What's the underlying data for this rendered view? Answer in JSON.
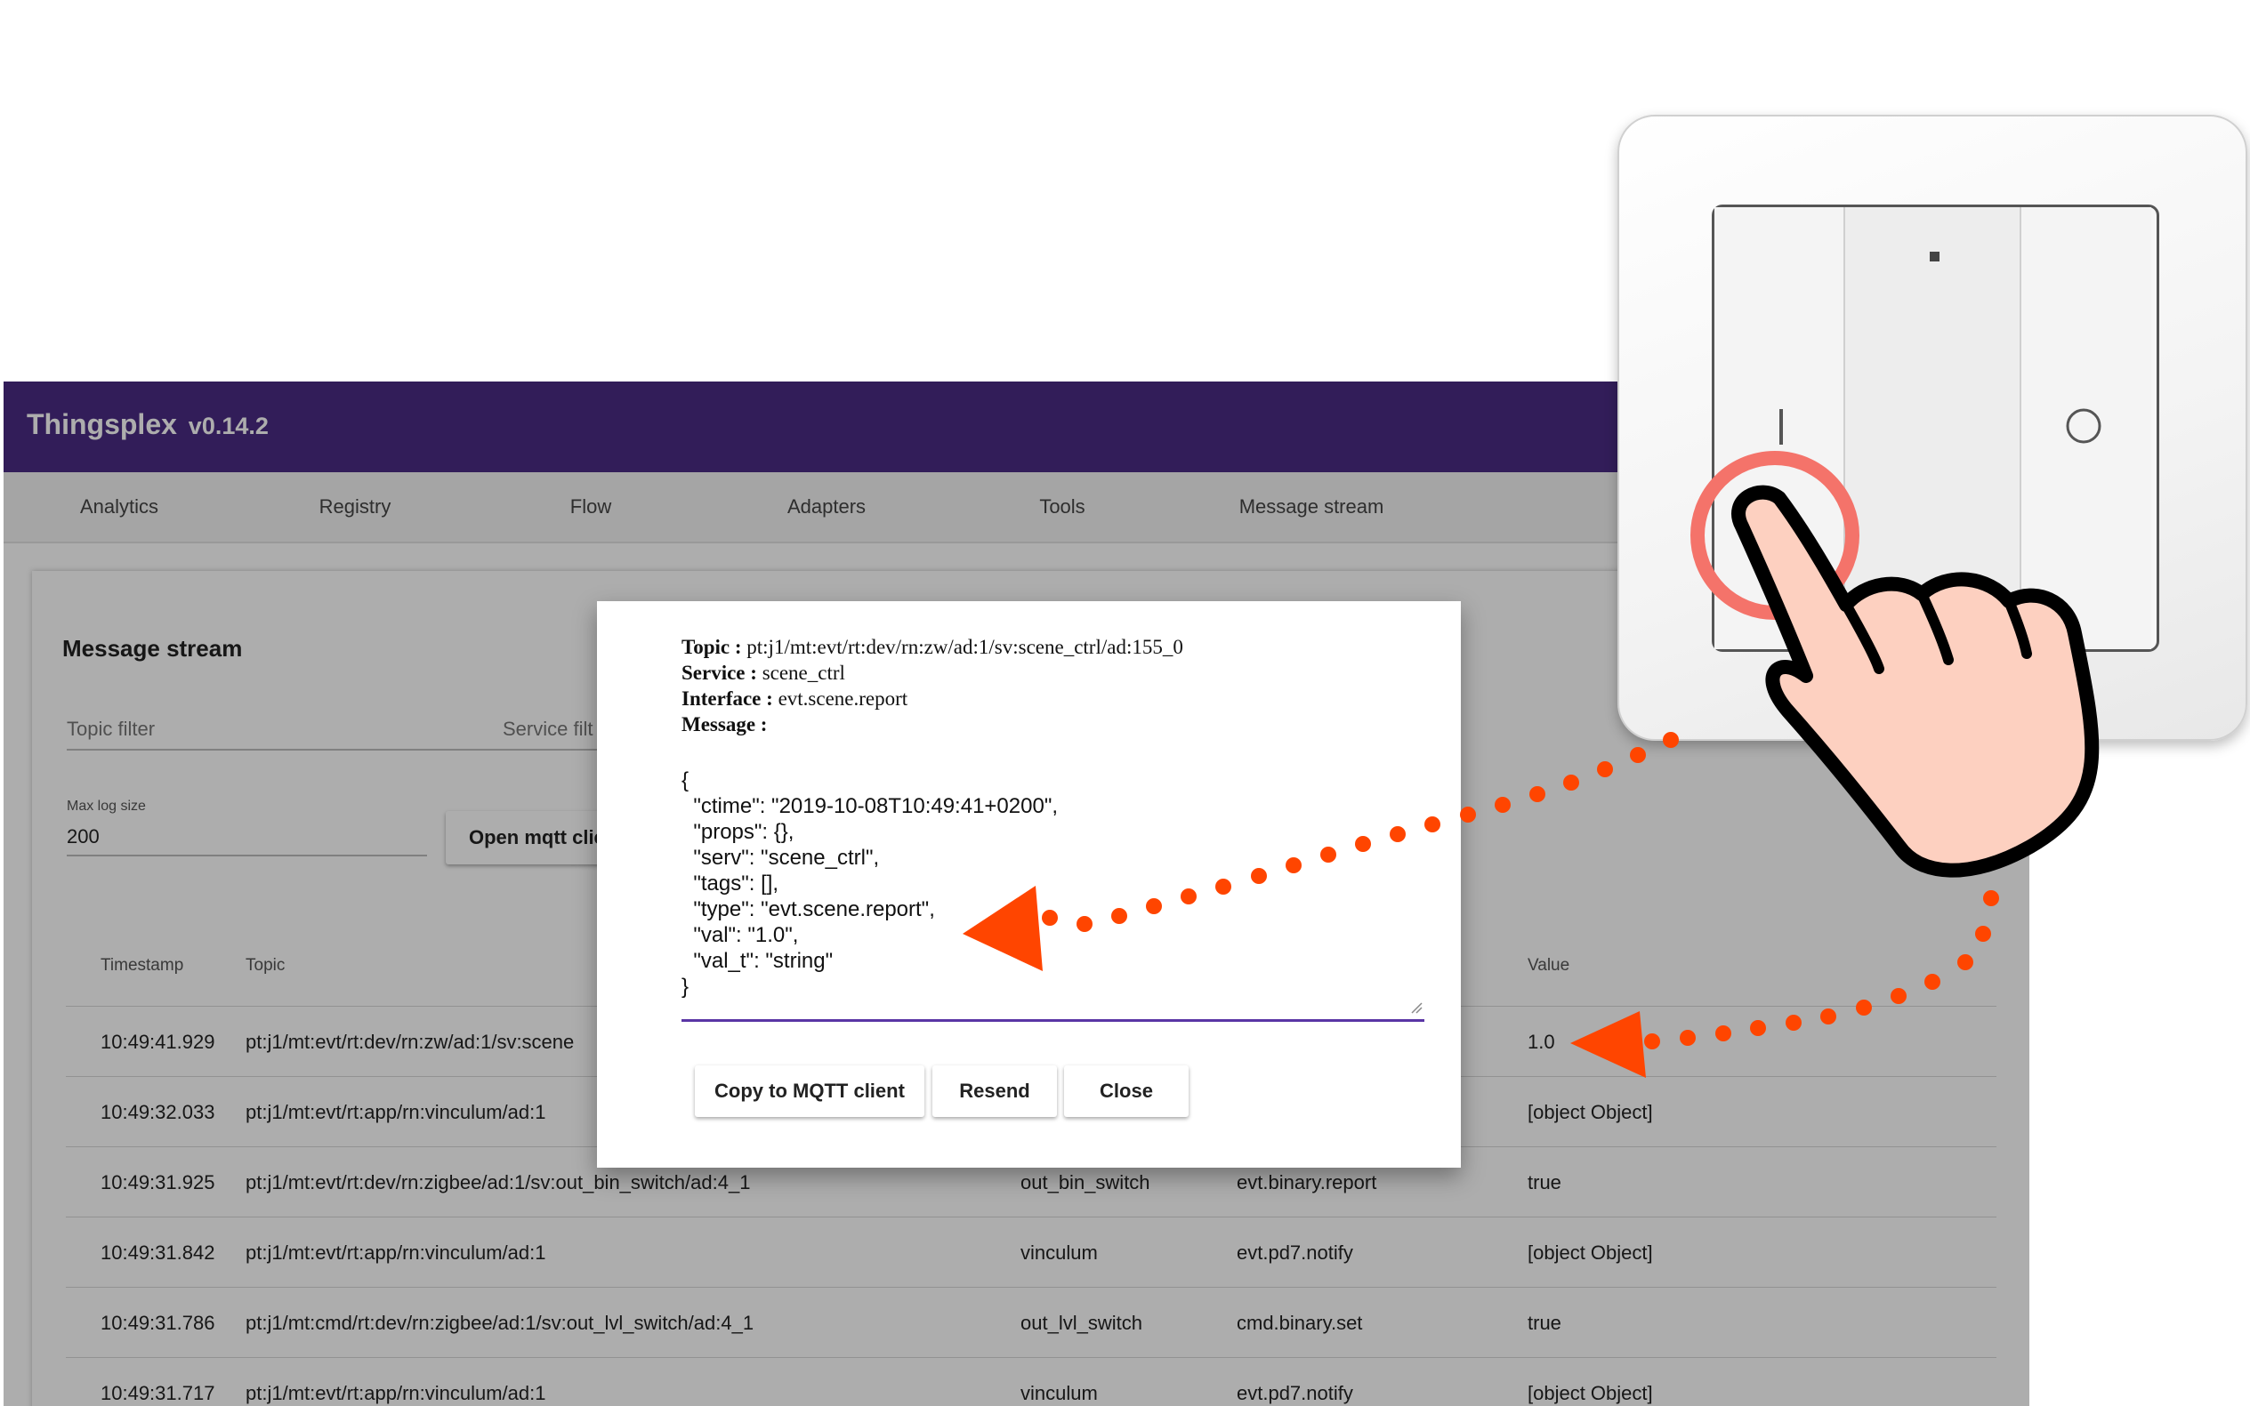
{
  "app": {
    "title": "Thingsplex",
    "version": "v0.14.2",
    "colors": {
      "appbar": "#4b2c84",
      "accent": "#5a35a5"
    }
  },
  "nav": {
    "tabs": [
      {
        "label": "Analytics"
      },
      {
        "label": "Registry"
      },
      {
        "label": "Flow"
      },
      {
        "label": "Adapters"
      },
      {
        "label": "Tools"
      },
      {
        "label": "Message stream"
      }
    ]
  },
  "stream": {
    "title": "Message stream",
    "topic_filter_label": "Topic filter",
    "service_filter_label": "Service filt",
    "max_log_label": "Max log size",
    "max_log_value": "200",
    "open_mqtt_label": "Open mqtt clie"
  },
  "table": {
    "headers": {
      "timestamp": "Timestamp",
      "topic": "Topic",
      "value": "Value"
    },
    "rows": [
      {
        "timestamp": "10:49:41.929",
        "topic": "pt:j1/mt:evt/rt:dev/rn:zw/ad:1/sv:scene",
        "service": "",
        "interface": "",
        "value": "1.0"
      },
      {
        "timestamp": "10:49:32.033",
        "topic": "pt:j1/mt:evt/rt:app/rn:vinculum/ad:1",
        "service": "",
        "interface": "",
        "value": "[object Object]"
      },
      {
        "timestamp": "10:49:31.925",
        "topic": "pt:j1/mt:evt/rt:dev/rn:zigbee/ad:1/sv:out_bin_switch/ad:4_1",
        "service": "out_bin_switch",
        "interface": "evt.binary.report",
        "value": "true"
      },
      {
        "timestamp": "10:49:31.842",
        "topic": "pt:j1/mt:evt/rt:app/rn:vinculum/ad:1",
        "service": "vinculum",
        "interface": "evt.pd7.notify",
        "value": "[object Object]"
      },
      {
        "timestamp": "10:49:31.786",
        "topic": "pt:j1/mt:cmd/rt:dev/rn:zigbee/ad:1/sv:out_lvl_switch/ad:4_1",
        "service": "out_lvl_switch",
        "interface": "cmd.binary.set",
        "value": "true"
      },
      {
        "timestamp": "10:49:31.717",
        "topic": "pt:j1/mt:evt/rt:app/rn:vinculum/ad:1",
        "service": "vinculum",
        "interface": "evt.pd7.notify",
        "value": "[object Object]"
      }
    ]
  },
  "dialog": {
    "topic_label": "Topic :",
    "topic_value": "pt:j1/mt:evt/rt:dev/rn:zw/ad:1/sv:scene_ctrl/ad:155_0",
    "service_label": "Service :",
    "service_value": "scene_ctrl",
    "interface_label": "Interface :",
    "interface_value": "evt.scene.report",
    "message_label": "Message :",
    "json_lines": [
      "{",
      "  \"ctime\": \"2019-10-08T10:49:41+0200\",",
      "  \"props\": {},",
      "  \"serv\": \"scene_ctrl\",",
      "  \"tags\": [],",
      "  \"type\": \"evt.scene.report\",",
      "  \"val\": \"1.0\",",
      "  \"val_t\": \"string\"",
      "}"
    ],
    "buttons": {
      "copy": "Copy to MQTT client",
      "resend": "Resend",
      "close": "Close"
    }
  },
  "illustration": {
    "device": "wall-switch-icon",
    "hand": "pointing-hand-icon",
    "colors": {
      "arrow": "#ff4500",
      "press_ring": "#f4736a",
      "hand_skin": "#fdd0c0"
    }
  }
}
